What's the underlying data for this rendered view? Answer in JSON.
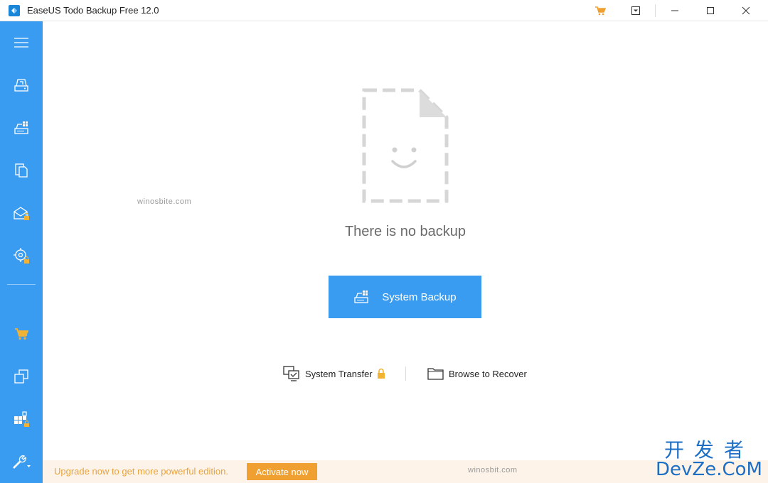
{
  "window": {
    "title": "EaseUS Todo Backup Free 12.0",
    "controls": {
      "minimize": "minimize",
      "maximize": "maximize",
      "close": "close"
    }
  },
  "titlebar_icons": [
    "cart-icon",
    "dropdown-menu-icon"
  ],
  "sidebar": {
    "items": [
      {
        "icon": "menu-icon"
      },
      {
        "icon": "disk-backup-icon"
      },
      {
        "icon": "system-backup-icon"
      },
      {
        "icon": "file-backup-icon"
      },
      {
        "icon": "mail-backup-locked-icon"
      },
      {
        "icon": "smart-backup-locked-icon"
      },
      {
        "icon": "cart-icon"
      },
      {
        "icon": "clone-icon"
      },
      {
        "icon": "apps-locked-icon"
      },
      {
        "icon": "tools-icon"
      }
    ]
  },
  "main": {
    "watermark": "winosbite.com",
    "empty_message": "There is no backup",
    "primary_button": {
      "label": "System Backup",
      "icon": "system-backup-icon"
    },
    "links": {
      "system_transfer": {
        "label": "System Transfer",
        "icon": "transfer-icon",
        "locked": true
      },
      "browse_recover": {
        "label": "Browse to Recover",
        "icon": "folder-icon"
      }
    }
  },
  "bottombar": {
    "upgrade_text": "Upgrade now to get more powerful edition.",
    "activate_label": "Activate now",
    "watermark": "winosbit.com"
  },
  "brand_watermark": {
    "cn": "开发者",
    "en": "DevZe.CoM"
  },
  "colors": {
    "accent": "#3a9cf0",
    "upgrade_bg": "#fdf3e8",
    "upgrade_text": "#e8a33d",
    "activate_bg": "#f0a030",
    "lock": "#f2b234",
    "brand": "#1d6fc6"
  }
}
